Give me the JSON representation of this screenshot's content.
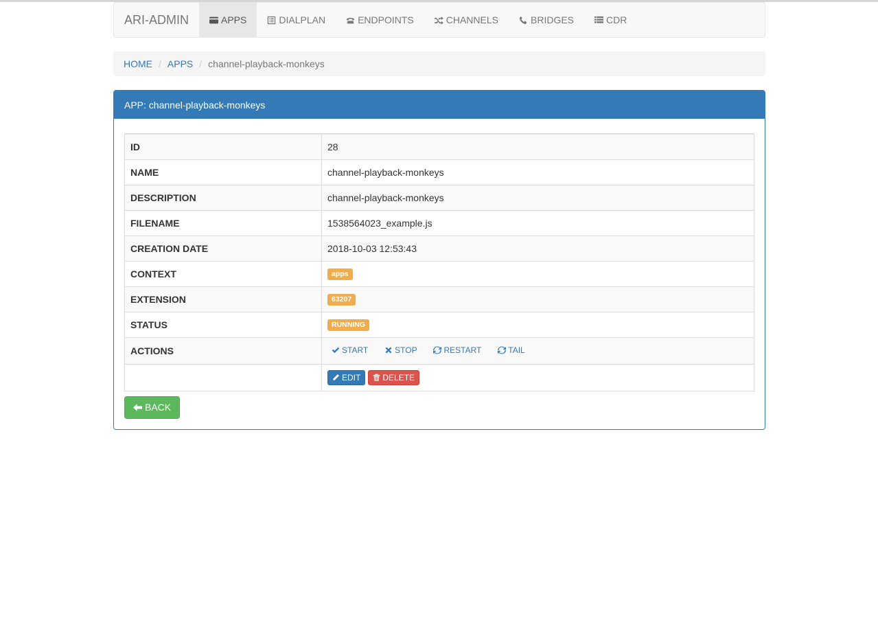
{
  "navbar": {
    "brand": "ARI-ADMIN",
    "items": [
      {
        "label": "APPS",
        "icon": "credit-card-icon",
        "active": true
      },
      {
        "label": "DIALPLAN",
        "icon": "list-alt-icon"
      },
      {
        "label": "ENDPOINTS",
        "icon": "phone-alt-icon"
      },
      {
        "label": "CHANNELS",
        "icon": "random-icon"
      },
      {
        "label": "BRIDGES",
        "icon": "earphone-icon"
      },
      {
        "label": "CDR",
        "icon": "list-icon"
      }
    ]
  },
  "breadcrumb": {
    "home": "HOME",
    "apps": "APPS",
    "current": "channel-playback-monkeys"
  },
  "panel": {
    "title": "APP: channel-playback-monkeys"
  },
  "details": {
    "id_label": "ID",
    "id_value": "28",
    "name_label": "NAME",
    "name_value": "channel-playback-monkeys",
    "description_label": "DESCRIPTION",
    "description_value": "channel-playback-monkeys",
    "filename_label": "FILENAME",
    "filename_value": "1538564023_example.js",
    "creation_date_label": "CREATION DATE",
    "creation_date_value": "2018-10-03 12:53:43",
    "context_label": "CONTEXT",
    "context_value": "apps",
    "extension_label": "EXTENSION",
    "extension_value": "63207",
    "status_label": "STATUS",
    "status_value": "RUNNING",
    "actions_label": "ACTIONS"
  },
  "actions": {
    "start": "START",
    "stop": "STOP",
    "restart": "RESTART",
    "tail": "TAIL",
    "edit": "EDIT",
    "delete": "DELETE",
    "back": "BACK"
  },
  "colors": {
    "primary": "#337ab7",
    "warning": "#f0ad4e",
    "danger": "#d9534f",
    "success": "#5cb85c"
  }
}
